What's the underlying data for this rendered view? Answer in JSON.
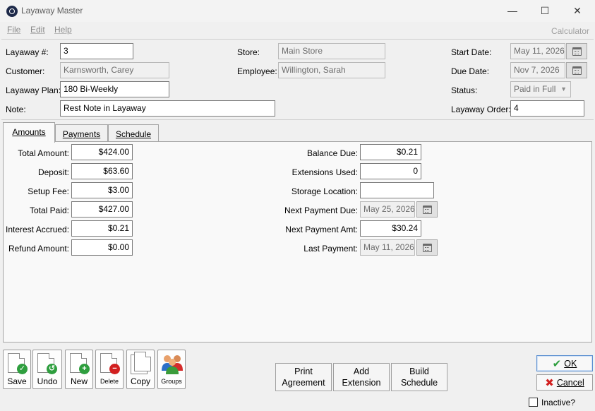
{
  "window": {
    "title": "Layaway Master",
    "minimize": "—",
    "maximize": "☐",
    "close": "✕"
  },
  "menu": {
    "file": "File",
    "edit": "Edit",
    "help": "Help",
    "calculator": "Calculator"
  },
  "header": {
    "layaway_no_label": "Layaway #:",
    "layaway_no": "3",
    "customer_label": "Customer:",
    "customer": "Karnsworth, Carey",
    "plan_label": "Layaway Plan:",
    "plan": "180 Bi-Weekly",
    "note_label": "Note:",
    "note": "Rest Note in Layaway",
    "store_label": "Store:",
    "store": "Main Store",
    "employee_label": "Employee:",
    "employee": "Willington, Sarah",
    "start_date_label": "Start Date:",
    "start_date": "May 11, 2026",
    "due_date_label": "Due Date:",
    "due_date": "Nov 7, 2026",
    "status_label": "Status:",
    "status": "Paid in Full",
    "order_label": "Layaway Order:",
    "order": "4"
  },
  "tabs": {
    "amounts": "Amounts",
    "payments": "Payments",
    "schedule": "Schedule"
  },
  "amounts": {
    "total_amount_label": "Total Amount:",
    "total_amount": "$424.00",
    "deposit_label": "Deposit:",
    "deposit": "$63.60",
    "setup_fee_label": "Setup Fee:",
    "setup_fee": "$3.00",
    "total_paid_label": "Total Paid:",
    "total_paid": "$427.00",
    "interest_label": "Interest Accrued:",
    "interest": "$0.21",
    "refund_label": "Refund Amount:",
    "refund": "$0.00",
    "balance_due_label": "Balance Due:",
    "balance_due": "$0.21",
    "extensions_label": "Extensions Used:",
    "extensions": "0",
    "storage_label": "Storage Location:",
    "storage": "",
    "next_due_label": "Next Payment Due:",
    "next_due": "May 25, 2026",
    "next_amt_label": "Next Payment Amt:",
    "next_amt": "$30.24",
    "last_payment_label": "Last Payment:",
    "last_payment": "May 11, 2026"
  },
  "toolbar": {
    "save": "Save",
    "undo": "Undo",
    "new": "New",
    "delete": "Delete",
    "copy": "Copy",
    "groups": "Groups"
  },
  "actions": {
    "print_line1": "Print",
    "print_line2": "Agreement",
    "add_line1": "Add",
    "add_line2": "Extension",
    "build_line1": "Build",
    "build_line2": "Schedule"
  },
  "dialog": {
    "ok": "OK",
    "cancel": "Cancel",
    "inactive": "Inactive?"
  },
  "colors": {
    "save": "#2e9e3e",
    "undo": "#2e9e3e",
    "new": "#2e9e3e",
    "delete": "#d22020",
    "ok": "#2e9e3e",
    "cancel": "#d22020"
  }
}
